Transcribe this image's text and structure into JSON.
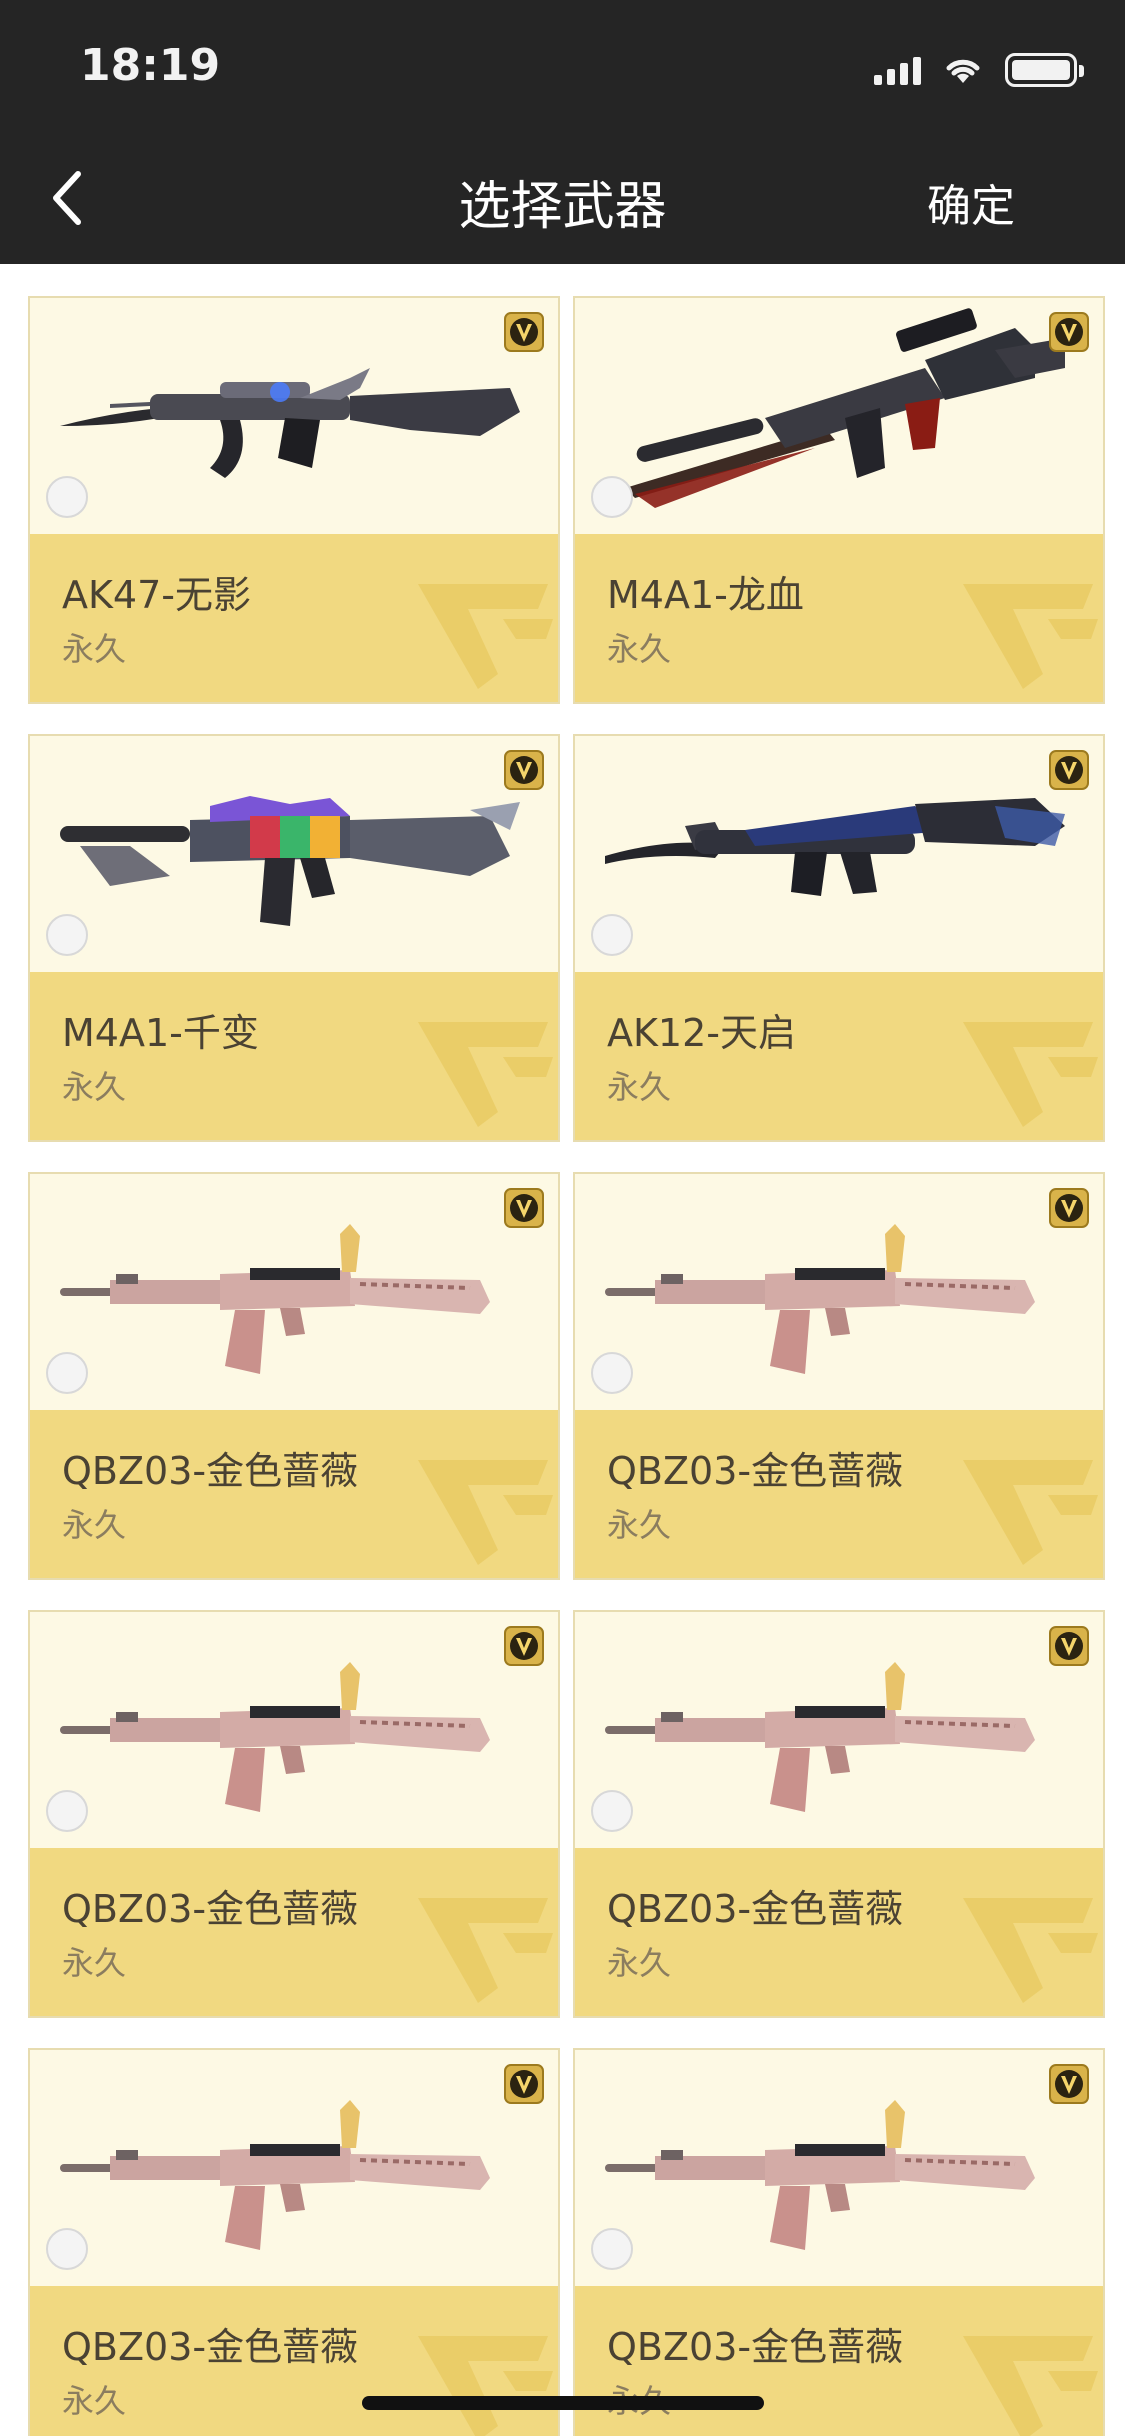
{
  "status_bar": {
    "time": "18:19"
  },
  "nav": {
    "title": "选择武器",
    "confirm_label": "确定"
  },
  "accent_colors": {
    "header_bg": "#252525",
    "card_info_bg": "#f1d981",
    "card_image_bg": "#fdf9e4"
  },
  "weapons": [
    {
      "name": "AK47-无影",
      "term": "永久",
      "style": "ak47"
    },
    {
      "name": "M4A1-龙血",
      "term": "永久",
      "style": "m4red"
    },
    {
      "name": "M4A1-千变",
      "term": "永久",
      "style": "m4rainbow"
    },
    {
      "name": "AK12-天启",
      "term": "永久",
      "style": "ak12"
    },
    {
      "name": "QBZ03-金色蔷薇",
      "term": "永久",
      "style": "qbz"
    },
    {
      "name": "QBZ03-金色蔷薇",
      "term": "永久",
      "style": "qbz"
    },
    {
      "name": "QBZ03-金色蔷薇",
      "term": "永久",
      "style": "qbz"
    },
    {
      "name": "QBZ03-金色蔷薇",
      "term": "永久",
      "style": "qbz"
    },
    {
      "name": "QBZ03-金色蔷薇",
      "term": "永久",
      "style": "qbz"
    },
    {
      "name": "QBZ03-金色蔷薇",
      "term": "永久",
      "style": "qbz"
    }
  ],
  "icons": {
    "back": "chevron-left-icon",
    "vip": "vip-badge-icon",
    "watermark": "cf-logo-icon"
  }
}
